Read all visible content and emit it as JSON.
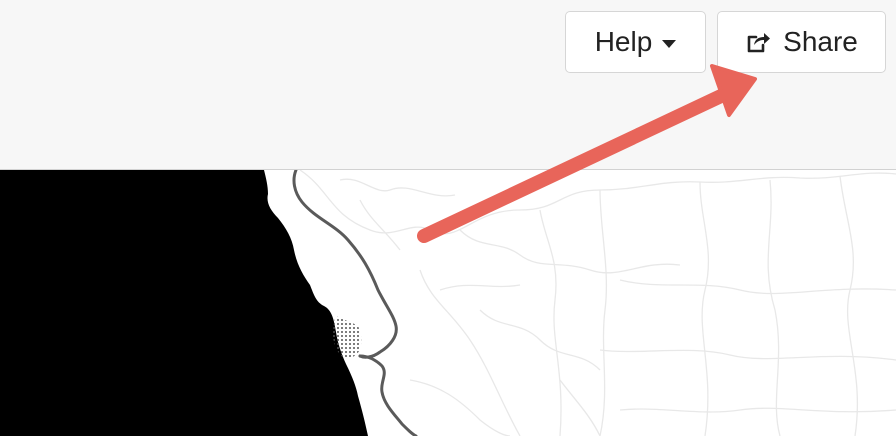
{
  "toolbar": {
    "help_label": "Help",
    "share_label": "Share"
  },
  "icons": {
    "help_caret": "caret-down-icon",
    "share": "share-square-icon"
  },
  "map": {
    "ocean_color": "#000000",
    "land_color": "#ffffff",
    "river_color": "#555555",
    "boundary_color": "#e6e6e6"
  },
  "annotation": {
    "arrow_color": "#e8655a"
  }
}
